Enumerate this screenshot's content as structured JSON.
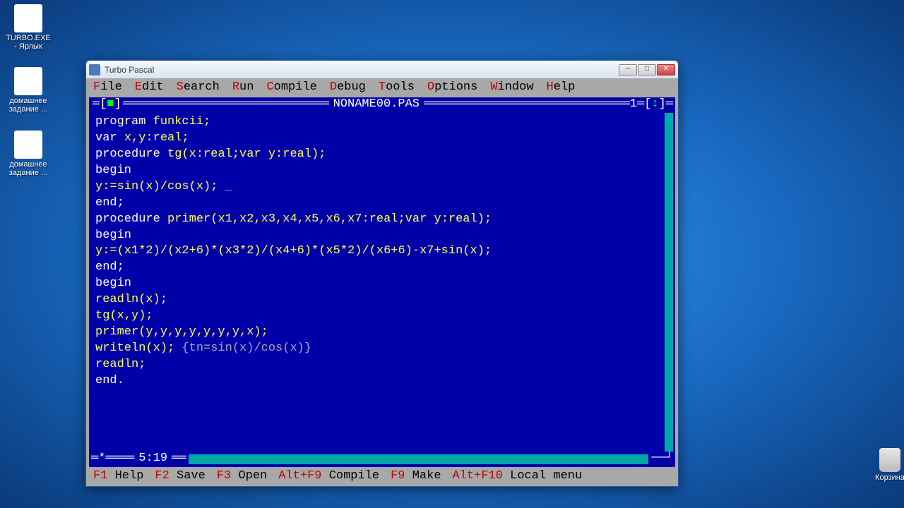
{
  "desktop": {
    "icons": [
      {
        "label": "TURBO.EXE - Ярлык"
      },
      {
        "label": "домашнее задание ..."
      },
      {
        "label": "домашнее задание ..."
      }
    ],
    "trash_label": "Корзина"
  },
  "window": {
    "title": "Turbo Pascal"
  },
  "menu": {
    "items": [
      {
        "hot": "F",
        "rest": "ile"
      },
      {
        "hot": "E",
        "rest": "dit"
      },
      {
        "hot": "S",
        "rest": "earch"
      },
      {
        "hot": "R",
        "rest": "un"
      },
      {
        "hot": "C",
        "rest": "ompile"
      },
      {
        "hot": "D",
        "rest": "ebug"
      },
      {
        "hot": "T",
        "rest": "ools"
      },
      {
        "hot": "O",
        "rest": "ptions"
      },
      {
        "hot": "W",
        "rest": "indow"
      },
      {
        "hot": "H",
        "rest": "elp"
      }
    ]
  },
  "editor": {
    "filename": "NONAME00.PAS",
    "window_number": "1",
    "cursor_pos": "5:19",
    "lines": [
      {
        "segments": [
          {
            "t": "program ",
            "c": "kw"
          },
          {
            "t": "funkcii;",
            "c": "ident"
          }
        ]
      },
      {
        "segments": [
          {
            "t": "var ",
            "c": "kw"
          },
          {
            "t": "x,y:real;",
            "c": "ident"
          }
        ]
      },
      {
        "segments": [
          {
            "t": "procedure ",
            "c": "kw"
          },
          {
            "t": "tg(x:real;var y:real);",
            "c": "ident"
          }
        ]
      },
      {
        "segments": [
          {
            "t": "begin",
            "c": "kw"
          }
        ]
      },
      {
        "segments": [
          {
            "t": "y:=sin(x)/cos(x); ",
            "c": "ident"
          },
          {
            "t": "_",
            "c": "cursor"
          }
        ]
      },
      {
        "segments": [
          {
            "t": "end;",
            "c": "kw"
          }
        ]
      },
      {
        "segments": [
          {
            "t": "procedure ",
            "c": "kw"
          },
          {
            "t": "primer(x1,x2,x3,x4,x5,x6,x7:real;var y:real);",
            "c": "ident"
          }
        ]
      },
      {
        "segments": [
          {
            "t": "begin",
            "c": "kw"
          }
        ]
      },
      {
        "segments": [
          {
            "t": "y:=(x1*2)/(x2+6)*(x3*2)/(x4+6)*(x5*2)/(x6+6)-x7+sin(x);",
            "c": "ident"
          }
        ]
      },
      {
        "segments": [
          {
            "t": "end;",
            "c": "kw"
          }
        ]
      },
      {
        "segments": [
          {
            "t": "begin",
            "c": "kw"
          }
        ]
      },
      {
        "segments": [
          {
            "t": "readln(x);",
            "c": "ident"
          }
        ]
      },
      {
        "segments": [
          {
            "t": "tg(x,y);",
            "c": "ident"
          }
        ]
      },
      {
        "segments": [
          {
            "t": "primer(y,y,y,y,y,y,y,x);",
            "c": "ident"
          }
        ]
      },
      {
        "segments": [
          {
            "t": "writeln(x); ",
            "c": "ident"
          },
          {
            "t": "{tn=sin(x)/cos(x)}",
            "c": "comment"
          }
        ]
      },
      {
        "segments": [
          {
            "t": "readln;",
            "c": "ident"
          }
        ]
      },
      {
        "segments": [
          {
            "t": "end.",
            "c": "kw"
          }
        ]
      }
    ]
  },
  "statusbar": {
    "items": [
      {
        "key": "F1",
        "label": "Help"
      },
      {
        "key": "F2",
        "label": "Save"
      },
      {
        "key": "F3",
        "label": "Open"
      },
      {
        "key": "Alt+F9",
        "label": "Compile"
      },
      {
        "key": "F9",
        "label": "Make"
      },
      {
        "key": "Alt+F10",
        "label": "Local menu"
      }
    ]
  }
}
